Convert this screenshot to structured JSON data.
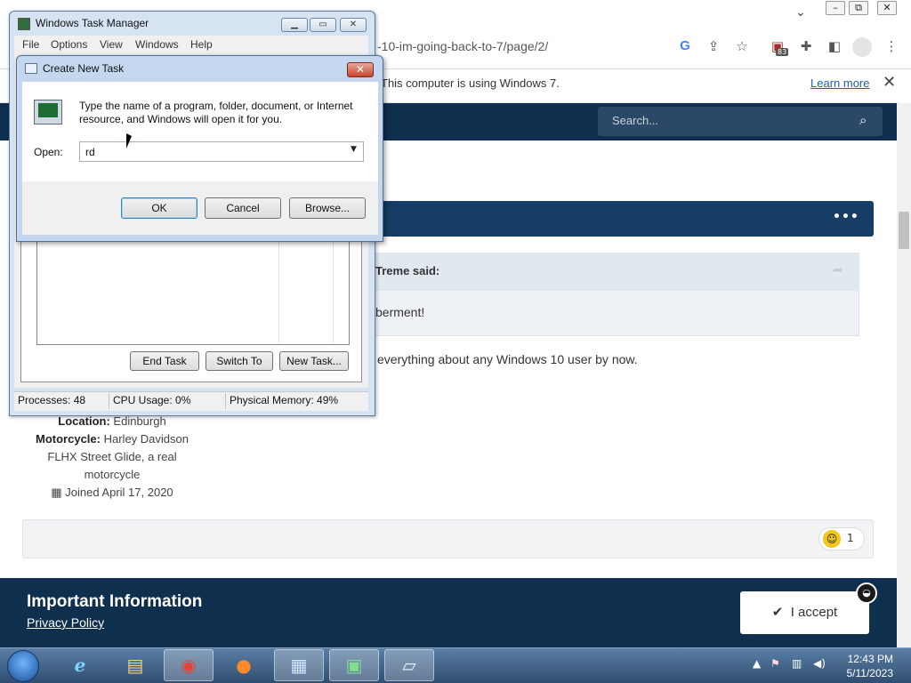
{
  "browser": {
    "url_visible": "-10-im-going-back-to-7/page/2/",
    "infobar_text": "This computer is using Windows 7.",
    "infobar_link": "Learn more",
    "controls": {
      "minimize": "▭",
      "restore": "⧉",
      "close": "✕",
      "chevron": "⌄"
    },
    "extension_badge": "83"
  },
  "site": {
    "search_placeholder": "Search...",
    "post_menu": "•••",
    "quote_author": "Treme said:",
    "quote_text": "berment!",
    "post_text": "everything about any Windows 10 user by now.",
    "user_info": {
      "location_label": "Location:",
      "location_value": "Edinburgh",
      "motorcycle_label": "Motorcycle:",
      "motorcycle_value_1": "Harley Davidson",
      "motorcycle_value_2": "FLHX Street Glide, a real",
      "motorcycle_value_3": "motorcycle",
      "joined": "Joined April 17, 2020"
    },
    "reaction_count": "1",
    "notice_title": "Important Information",
    "notice_link": "Privacy Policy",
    "accept_label": "I accept"
  },
  "task_manager": {
    "title": "Windows Task Manager",
    "menu": [
      "File",
      "Options",
      "View",
      "Windows",
      "Help"
    ],
    "buttons": {
      "end_task": "End Task",
      "switch_to": "Switch To",
      "new_task": "New Task..."
    },
    "status": {
      "processes": "Processes: 48",
      "cpu": "CPU Usage: 0%",
      "memory": "Physical Memory: 49%"
    }
  },
  "dialog": {
    "title": "Create New Task",
    "message": "Type the name of a program, folder, document, or Internet resource, and Windows will open it for you.",
    "open_label": "Open:",
    "open_value": "rd",
    "ok": "OK",
    "cancel": "Cancel",
    "browse": "Browse..."
  },
  "taskbar": {
    "time": "12:43 PM",
    "date": "5/11/2023"
  }
}
